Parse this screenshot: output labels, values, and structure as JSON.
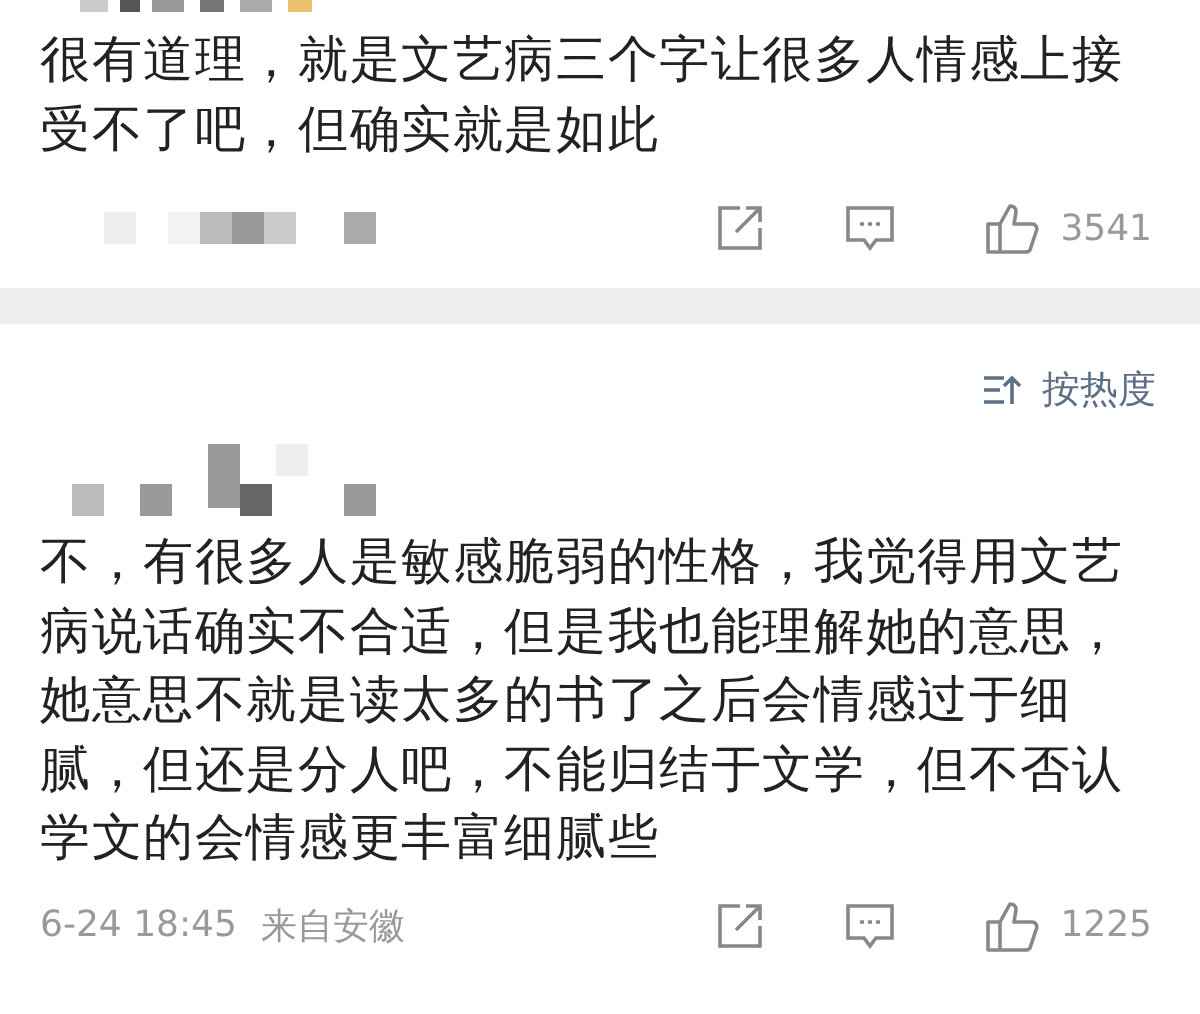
{
  "comments": [
    {
      "text": "很有道理，就是文艺病三个字让很多人情感上接受不了吧，但确实就是如此",
      "likes": "3541"
    },
    {
      "text": "不，有很多人是敏感脆弱的性格，我觉得用文艺病说话确实不合适，但是我也能理解她的意思，她意思不就是读太多的书了之后会情感过于细腻，但还是分人吧，不能归结于文学，但不否认学文的会情感更丰富细腻些",
      "time": "6-24 18:45",
      "source": "来自安徽",
      "likes": "1225"
    }
  ],
  "sort": {
    "label": "按热度"
  }
}
